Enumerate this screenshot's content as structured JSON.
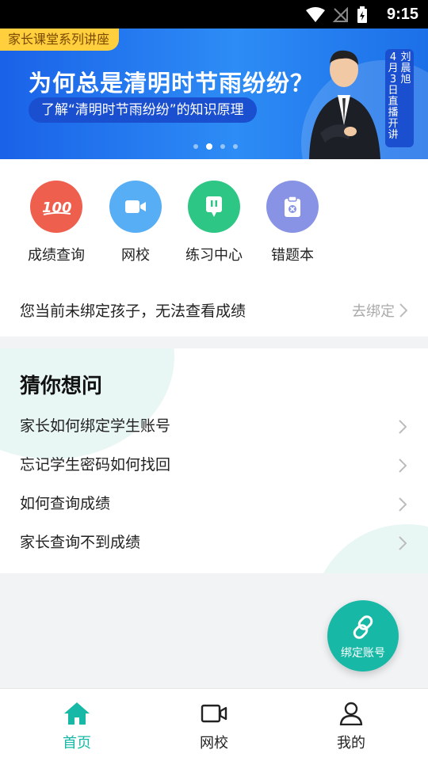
{
  "status_bar": {
    "time": "9:15"
  },
  "banner": {
    "tag": "家长课堂系列讲座",
    "headline": "为何总是清明时节雨纷纷？",
    "subtitle": "了解“清明时节雨纷纷”的知识原理",
    "vertical_label_col1": "刘晨旭",
    "vertical_label_col2": "4月3日直播开讲",
    "slide_count": 4,
    "active_slide": 2
  },
  "shortcuts": [
    {
      "label": "成绩查询",
      "icon": "score-100-icon",
      "color": "#ee5f4e"
    },
    {
      "label": "网校",
      "icon": "video-camera-icon",
      "color": "#58aef4"
    },
    {
      "label": "练习中心",
      "icon": "practice-icon",
      "color": "#2ec685"
    },
    {
      "label": "错题本",
      "icon": "mistake-book-icon",
      "color": "#8893e6"
    }
  ],
  "bind_notice": {
    "message": "您当前未绑定孩子，无法查看成绩",
    "action": "去绑定"
  },
  "faq": {
    "title": "猜你想问",
    "items": [
      "家长如何绑定学生账号",
      "忘记学生密码如何找回",
      "如何查询成绩",
      "家长查询不到成绩"
    ]
  },
  "fab": {
    "label": "绑定账号",
    "icon": "link-icon"
  },
  "tabbar": [
    {
      "label": "首页",
      "icon": "home-icon",
      "active": true
    },
    {
      "label": "网校",
      "icon": "video-camera-icon",
      "active": false
    },
    {
      "label": "我的",
      "icon": "user-icon",
      "active": false
    }
  ],
  "colors": {
    "accent": "#17b8a6",
    "banner_blue": "#2d8cf5",
    "tag_yellow": "#ffcf3d"
  }
}
